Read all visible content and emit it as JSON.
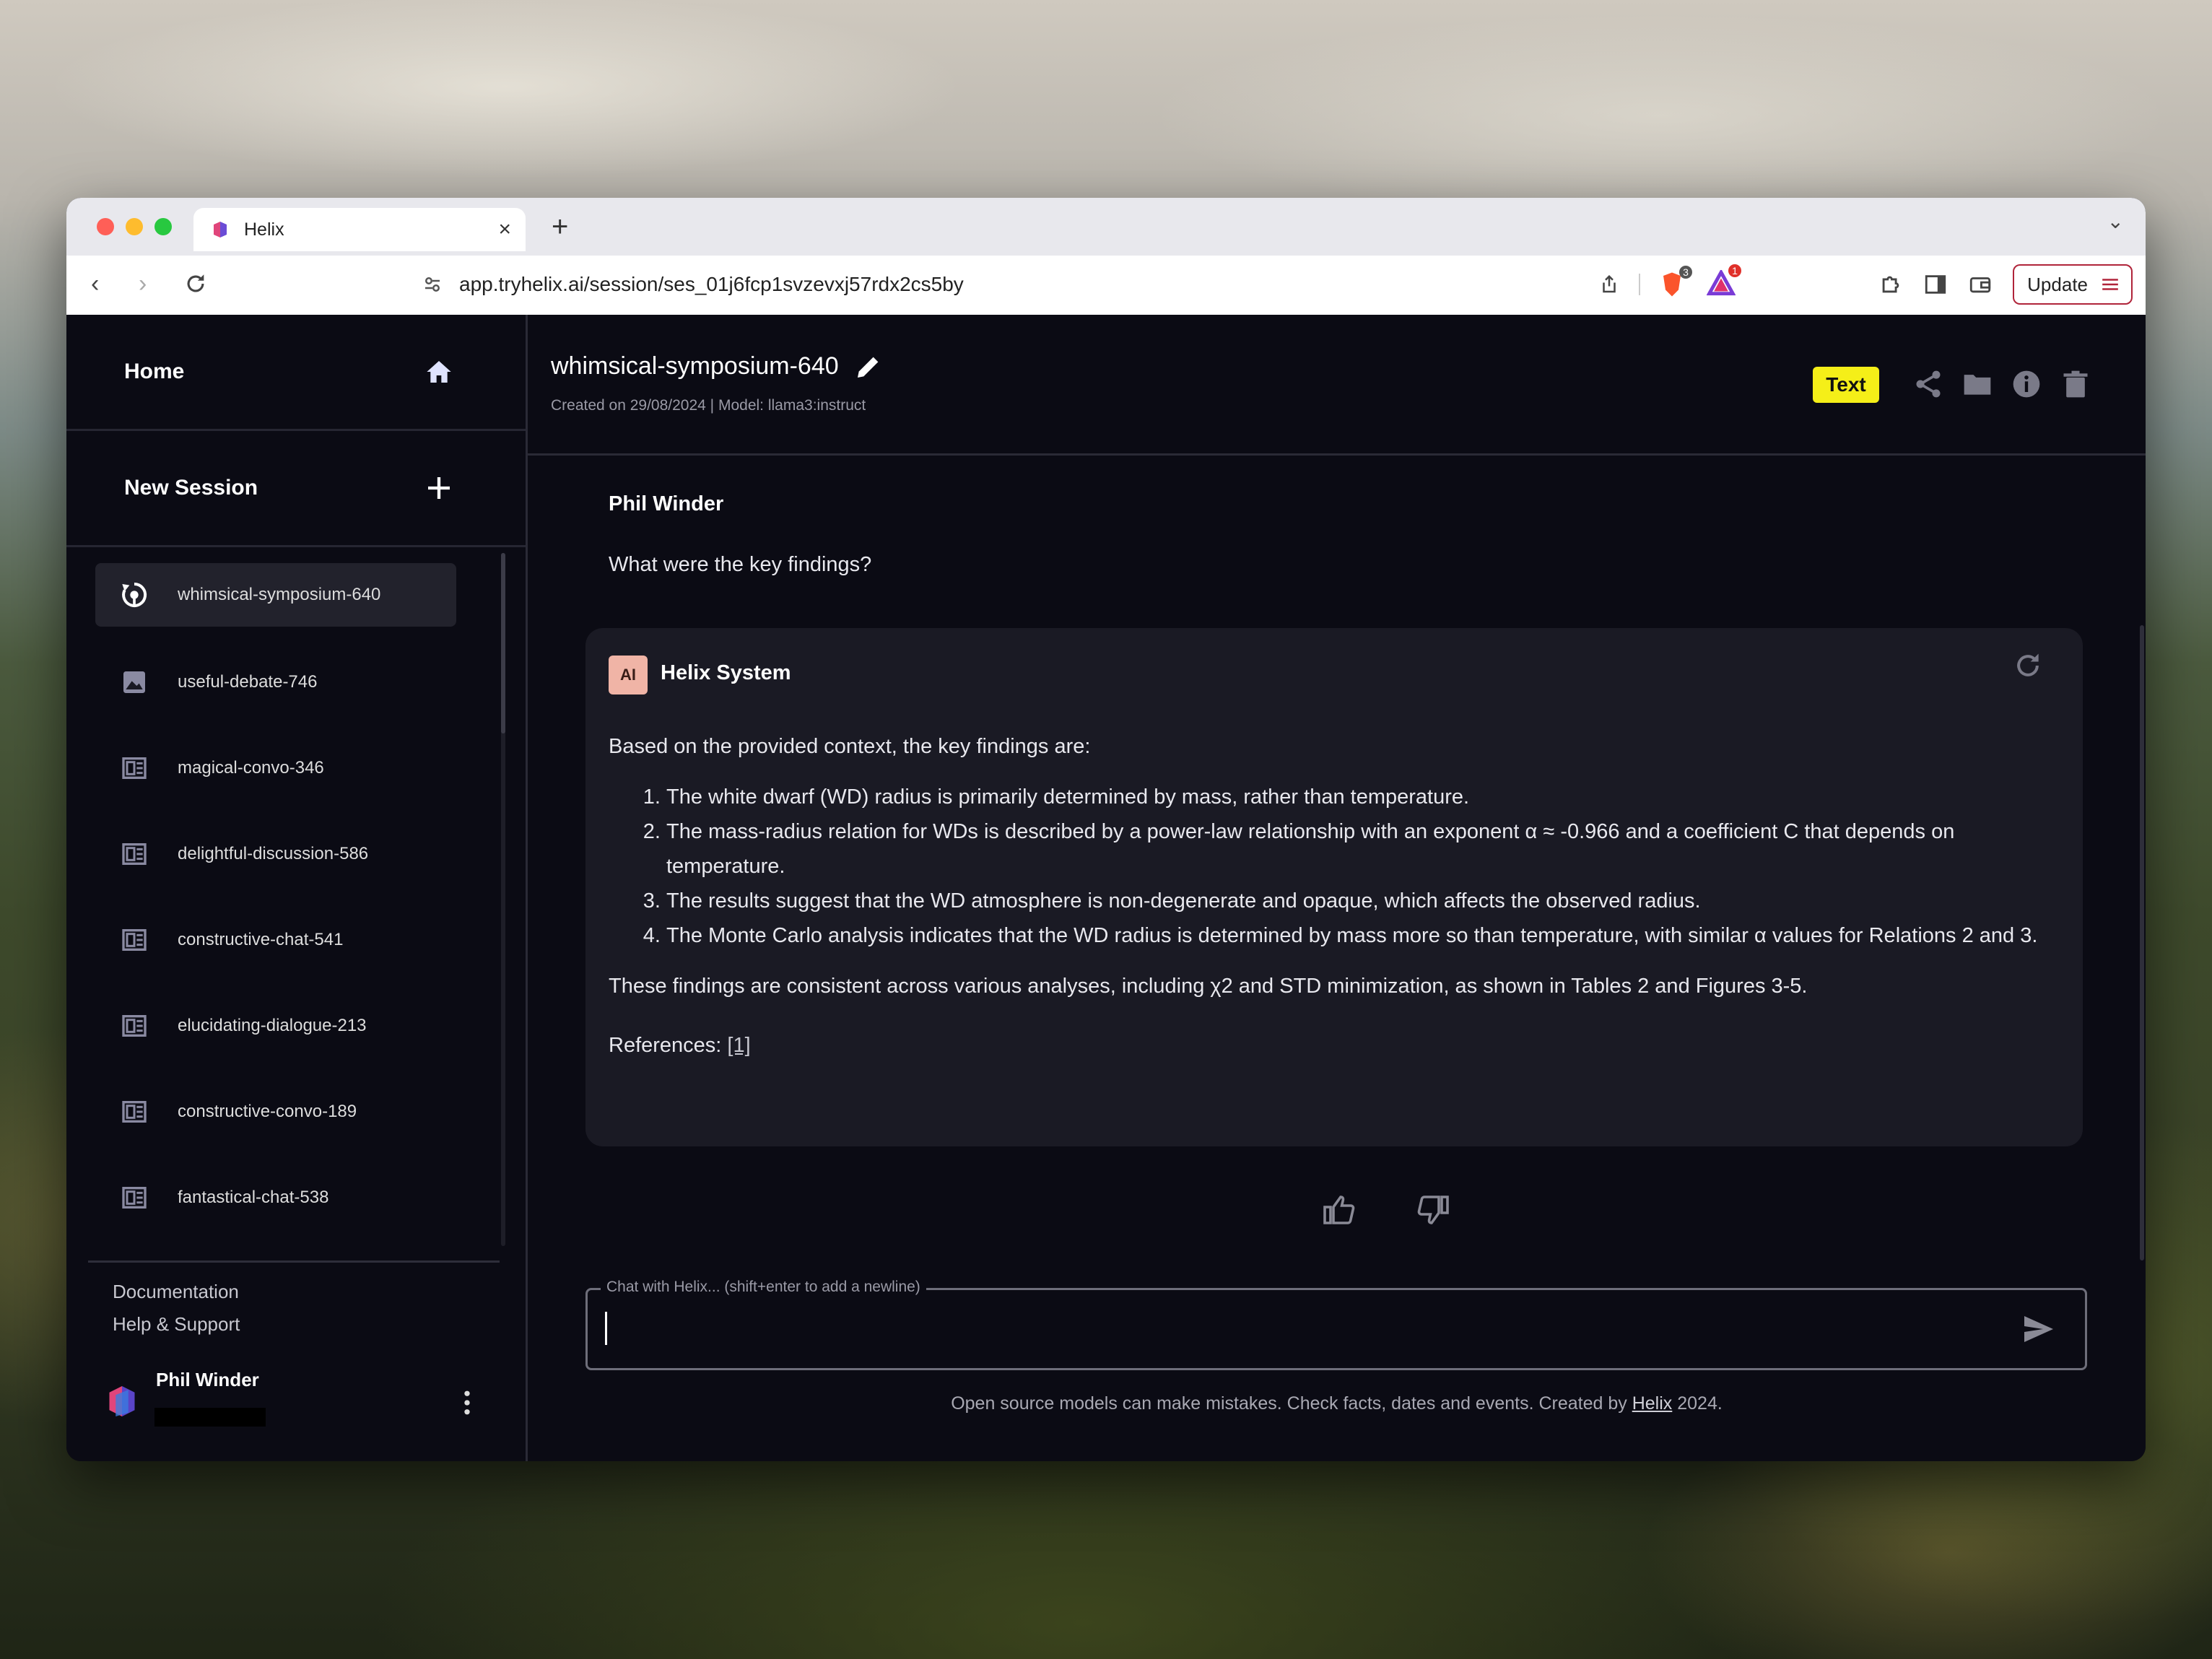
{
  "browser": {
    "tab_title": "Helix",
    "url": "app.tryhelix.ai/session/ses_01j6fcp1svzevxj57rdx2cs5by",
    "update_label": "Update",
    "brave_badge": "3",
    "rewards_badge": "1"
  },
  "sidebar": {
    "home_label": "Home",
    "new_session_label": "New Session",
    "sessions": [
      {
        "label": "whimsical-symposium-640",
        "icon": "text-session-icon"
      },
      {
        "label": "useful-debate-746",
        "icon": "image-icon"
      },
      {
        "label": "magical-convo-346",
        "icon": "document-icon"
      },
      {
        "label": "delightful-discussion-586",
        "icon": "document-icon"
      },
      {
        "label": "constructive-chat-541",
        "icon": "document-icon"
      },
      {
        "label": "elucidating-dialogue-213",
        "icon": "document-icon"
      },
      {
        "label": "constructive-convo-189",
        "icon": "document-icon"
      },
      {
        "label": "fantastical-chat-538",
        "icon": "document-icon"
      }
    ],
    "documentation_label": "Documentation",
    "help_label": "Help & Support",
    "user_name": "Phil Winder"
  },
  "header": {
    "title": "whimsical-symposium-640",
    "meta": "Created on 29/08/2024 | Model: llama3:instruct",
    "mode_badge": "Text"
  },
  "conversation": {
    "user_name": "Phil Winder",
    "user_message": "What were the key findings?",
    "ai_avatar": "AI",
    "ai_name": "Helix System",
    "ai_intro": "Based on the provided context, the key findings are:",
    "ai_points": [
      "The white dwarf (WD) radius is primarily determined by mass, rather than temperature.",
      "The mass-radius relation for WDs is described by a power-law relationship with an exponent α ≈ -0.966 and a coefficient C that depends on temperature.",
      "The results suggest that the WD atmosphere is non-degenerate and opaque, which affects the observed radius.",
      "The Monte Carlo analysis indicates that the WD radius is determined by mass more so than temperature, with similar α values for Relations 2 and 3."
    ],
    "ai_conclusion": "These findings are consistent across various analyses, including χ2 and STD minimization, as shown in Tables 2 and Figures 3-5.",
    "references_label": "References: ",
    "reference_link": "[1]"
  },
  "chat": {
    "label": "Chat with Helix... (shift+enter to add a newline)",
    "value": ""
  },
  "footer": {
    "note_prefix": "Open source models can make mistakes. Check facts, dates and events. Created by ",
    "note_link": "Helix",
    "note_suffix": " 2024."
  },
  "colors": {
    "app_bg": "#0b0b14",
    "card_bg": "#1a1a24",
    "badge_yellow": "#f5ef18",
    "avatar_bg": "#f0b4a6",
    "update_border": "#b0243a"
  }
}
